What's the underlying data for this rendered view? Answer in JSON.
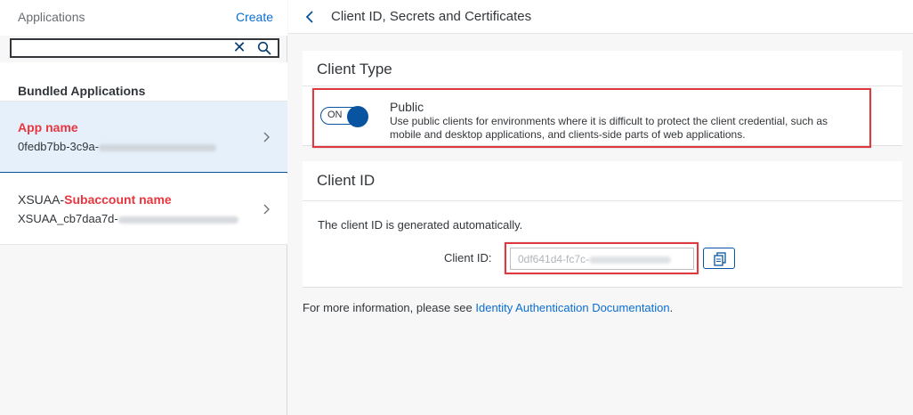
{
  "sidebar": {
    "title": "Applications",
    "create_label": "Create",
    "search": {
      "value": "",
      "placeholder": ""
    },
    "section_title": "Bundled Applications",
    "items": [
      {
        "name": "App name",
        "sub_prefix": "0fedb7bb-3c9a-",
        "selected": true
      },
      {
        "name_prefix": "XSUAA-",
        "name_highlight": "Subaccount name",
        "sub_prefix": "XSUAA_cb7daa7d-"
      }
    ]
  },
  "main": {
    "title": "Client ID, Secrets and Certificates",
    "client_type": {
      "heading": "Client Type",
      "toggle_label": "ON",
      "option_title": "Public",
      "option_desc": "Use public clients for environments where it is difficult to protect the client credential, such as mobile and desktop applications, and clients-side parts of web applications."
    },
    "client_id": {
      "heading": "Client ID",
      "info": "The client ID is generated automatically.",
      "label": "Client ID:",
      "value_prefix": "0df641d4-fc7c-"
    },
    "footer": {
      "text": "For more information, please see ",
      "link": "Identity Authentication Documentation",
      "suffix": "."
    }
  },
  "colors": {
    "accent": "#0854a0",
    "link": "#0a6ed1",
    "highlight_red": "#e9363f",
    "selected_bg": "#e5f0fa"
  },
  "icons": [
    "clear-icon",
    "search-icon",
    "chevron-right-icon",
    "back-chevron-icon",
    "copy-icon"
  ]
}
